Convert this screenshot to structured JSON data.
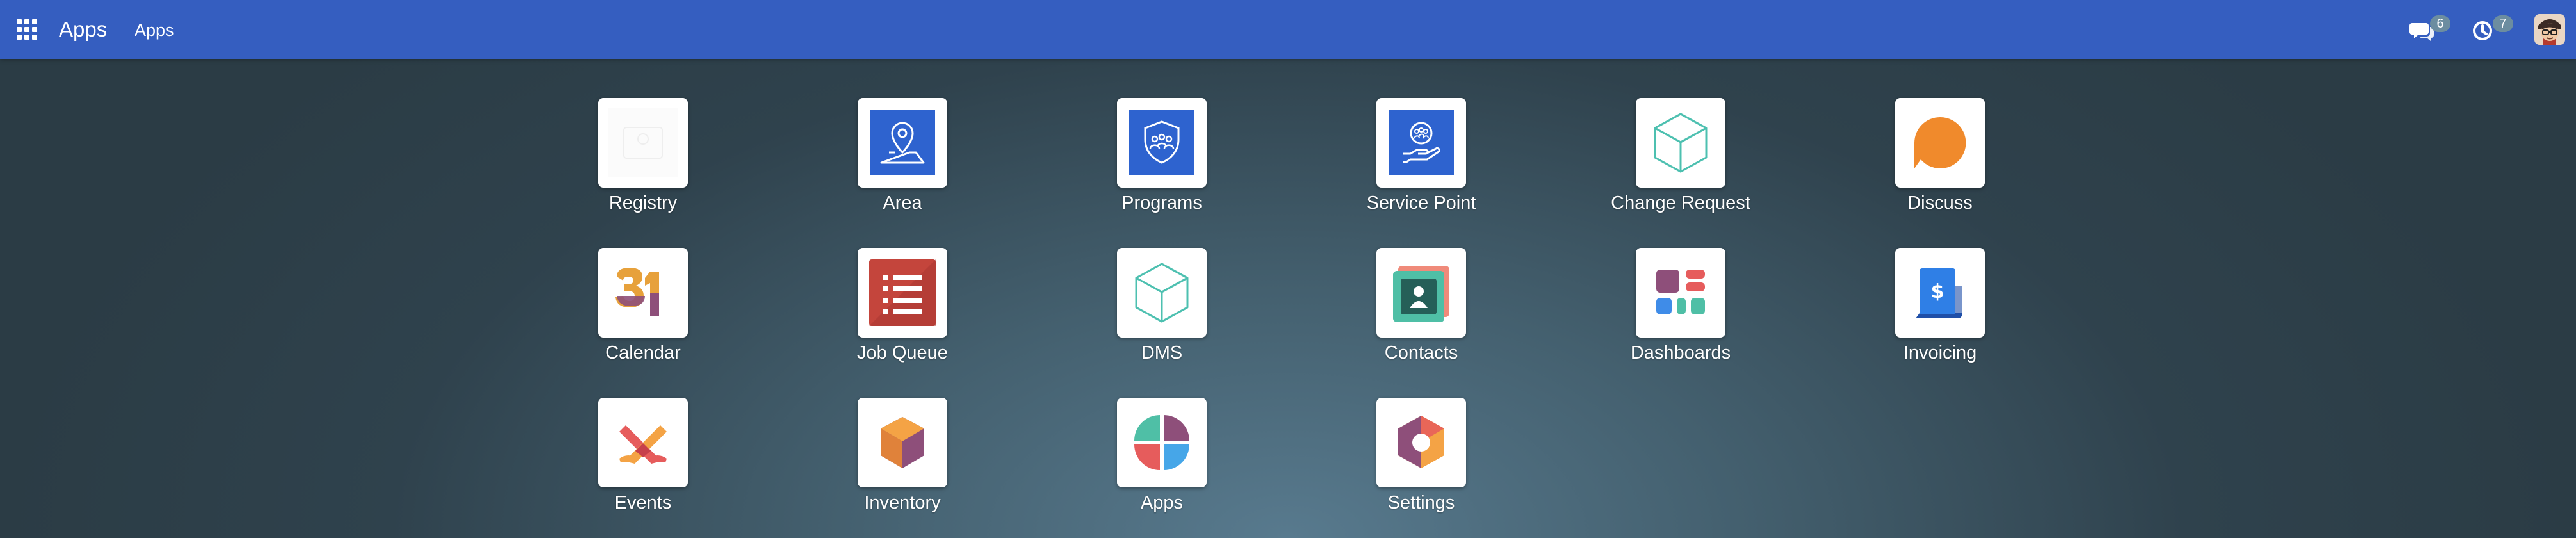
{
  "topbar": {
    "brand": "Apps",
    "nav_item": "Apps",
    "messages_count": "6",
    "activities_count": "7",
    "bar_color": "#355ec0"
  },
  "apps": [
    {
      "label": "Registry",
      "icon": "registry-icon"
    },
    {
      "label": "Area",
      "icon": "map-pin-icon"
    },
    {
      "label": "Programs",
      "icon": "shield-group-icon"
    },
    {
      "label": "Service Point",
      "icon": "hand-group-icon"
    },
    {
      "label": "Change Request",
      "icon": "cube-icon"
    },
    {
      "label": "Discuss",
      "icon": "chat-bubble-icon"
    },
    {
      "label": "Calendar",
      "icon": "calendar-icon"
    },
    {
      "label": "Job Queue",
      "icon": "list-icon"
    },
    {
      "label": "DMS",
      "icon": "cube-icon"
    },
    {
      "label": "Contacts",
      "icon": "contact-card-icon"
    },
    {
      "label": "Dashboards",
      "icon": "dashboard-icon"
    },
    {
      "label": "Invoicing",
      "icon": "invoice-icon"
    },
    {
      "label": "Events",
      "icon": "events-icon"
    },
    {
      "label": "Inventory",
      "icon": "box-hexagon-icon"
    },
    {
      "label": "Apps",
      "icon": "apps-pinwheel-icon"
    },
    {
      "label": "Settings",
      "icon": "settings-hexagon-icon"
    }
  ]
}
